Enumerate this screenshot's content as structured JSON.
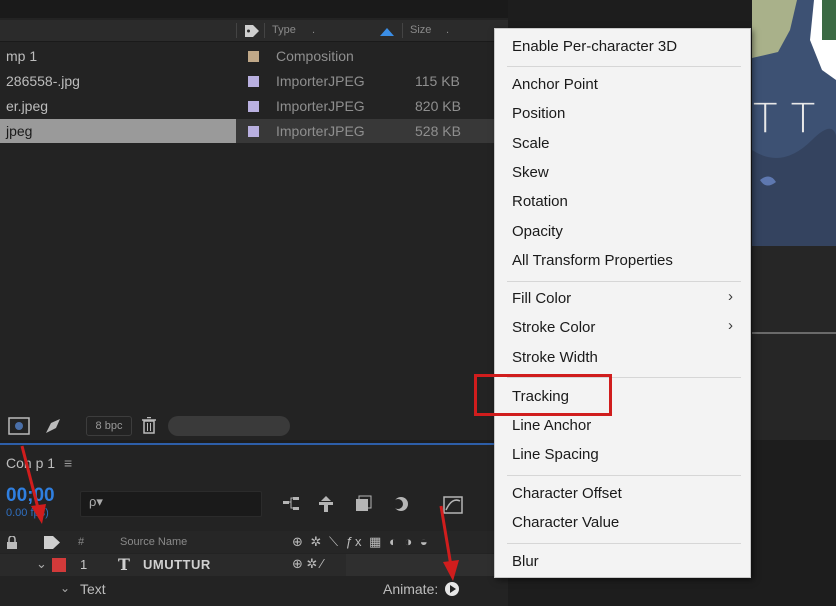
{
  "project_panel": {
    "headers": {
      "type": "Type",
      "size": "Size"
    },
    "rows": [
      {
        "name": "mp 1",
        "type": "Composition",
        "size": "",
        "swatch": "#c0a888"
      },
      {
        "name": "286558-.jpg",
        "type": "ImporterJPEG",
        "size": "115 KB",
        "swatch": "#b9b0e0"
      },
      {
        "name": "er.jpeg",
        "type": "ImporterJPEG",
        "size": "820 KB",
        "swatch": "#b9b0e0"
      },
      {
        "name": "jpeg",
        "type": "ImporterJPEG",
        "size": "528 KB",
        "swatch": "#b9b0e0"
      }
    ],
    "footer": {
      "bpc": "8 bpc"
    }
  },
  "viewer": {
    "big_text": "TT"
  },
  "timeline": {
    "title": "Con p 1",
    "menu_glyph": "≡",
    "time": "00;00",
    "fps": "0.00 fps)",
    "search_placeholder": "ρ▾",
    "columns": {
      "hash": "#",
      "source_name": "Source Name"
    },
    "layer": {
      "number": "1",
      "type_glyph": "T",
      "name": "UMUTTUR"
    },
    "sub": {
      "label": "Text",
      "animate": "Animate:"
    }
  },
  "context_menu": {
    "groups": [
      [
        "Enable Per-character 3D"
      ],
      [
        "Anchor Point",
        "Position",
        "Scale",
        "Skew",
        "Rotation",
        "Opacity",
        "All Transform Properties"
      ],
      [
        "Fill Color",
        "Stroke Color",
        "Stroke Width"
      ],
      [
        "Tracking",
        "Line Anchor",
        "Line Spacing"
      ],
      [
        "Character Offset",
        "Character Value"
      ],
      [
        "Blur"
      ]
    ],
    "submenu_arrow": "›",
    "highlighted_item": "Tracking"
  },
  "colors": {
    "highlight": "#d01d1d",
    "timecode": "#2f7fe0",
    "layer_label": "#d23a3a",
    "menu_bg": "#f3f3f3"
  }
}
